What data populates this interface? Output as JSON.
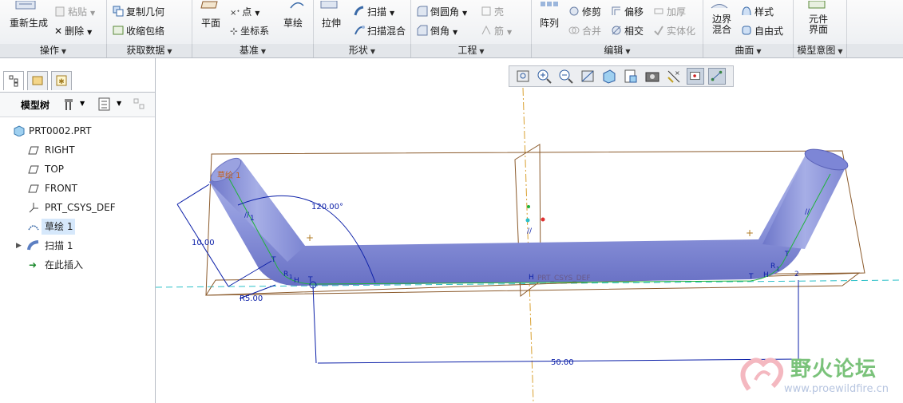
{
  "ribbon": {
    "operations": {
      "regenerate": "重新生成",
      "paste": "粘贴",
      "delete": "删除"
    },
    "get_data": {
      "copy_geometry": "复制几何",
      "shrinkwrap": "收缩包络"
    },
    "datum": {
      "plane": "平面",
      "point": "点",
      "csys": "坐标系",
      "sketch": "草绘"
    },
    "shapes": {
      "extrude": "拉伸",
      "sweep": "扫描",
      "swept_blend": "扫描混合"
    },
    "engineering": {
      "round": "倒圆角",
      "chamfer": "倒角",
      "shell": "壳",
      "rib": "筋"
    },
    "editing": {
      "pattern": "阵列",
      "trim": "修剪",
      "offset": "偏移",
      "thicken": "加厚",
      "merge": "合并",
      "intersect": "相交",
      "solidify": "实体化"
    },
    "surfaces": {
      "boundary_blend_1": "边界",
      "boundary_blend_2": "混合",
      "style": "样式",
      "freestyle": "自由式"
    },
    "model_intent": {
      "ui_1": "元件",
      "ui_2": "界面"
    },
    "groups": [
      "操作",
      "获取数据",
      "基准",
      "形状",
      "工程",
      "编辑",
      "曲面",
      "模型意图"
    ]
  },
  "panel": {
    "tree_title": "模型树",
    "items": [
      {
        "label": "PRT0002.PRT",
        "icon": "part-icon"
      },
      {
        "label": "RIGHT",
        "icon": "datum-plane-icon"
      },
      {
        "label": "TOP",
        "icon": "datum-plane-icon"
      },
      {
        "label": "FRONT",
        "icon": "datum-plane-icon"
      },
      {
        "label": "PRT_CSYS_DEF",
        "icon": "csys-icon"
      },
      {
        "label": "草绘 1",
        "icon": "sketch-icon"
      },
      {
        "label": "扫描 1",
        "icon": "sweep-icon"
      },
      {
        "label": "在此插入",
        "icon": "insert-here-icon"
      }
    ]
  },
  "canvas": {
    "sketch_label": "草绘 1",
    "dim_angle": "120.00°",
    "dim_length": "10.00",
    "dim_radius": "R5.00",
    "dim_width": "50.00",
    "csys_label": "PRT_CSYS_DEF",
    "tan_T": "T",
    "tan_H": "H",
    "r1": "R",
    "sub1": "1",
    "cons_1": "1",
    "cons_2": "2",
    "parallel": "//"
  },
  "watermark": {
    "title": "野火论坛",
    "url": "www.proewildfire.cn"
  },
  "colors": {
    "accent": "#2f5fb0",
    "solid": "#8e97dd",
    "dim": "#0b1fa8",
    "sketch": "#1fb33a",
    "datum": "#8b5a2b",
    "axis": "#2bc0c8"
  }
}
